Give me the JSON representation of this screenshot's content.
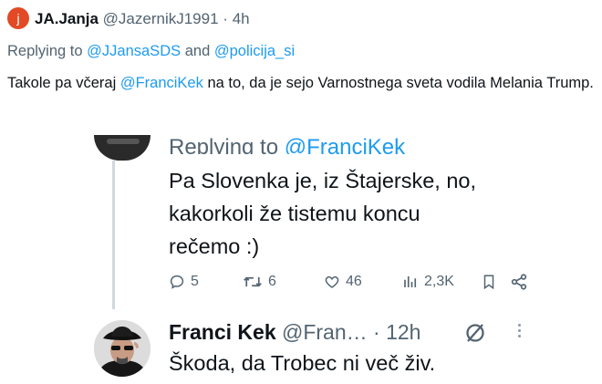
{
  "header": {
    "avatar_letter": "j",
    "display_name": "JA.Janja",
    "handle": "@JazernikJ1991",
    "separator": "·",
    "time": "4h"
  },
  "replying": {
    "prefix": "Replying to",
    "user1": "@JJansaSDS",
    "conj": "and",
    "user2": "@policija_si"
  },
  "body": {
    "text_before": "Takole pa včeraj  ",
    "mention": "@FranciKek",
    "text_after": " na to, da je sejo Varnostnega sveta  vodila Melania Trump."
  },
  "embed": {
    "replying_prefix": "Replying to",
    "replying_user": "@FranciKek",
    "lines": [
      "Pa Slovenka je, iz Štajerske, no,",
      "kakorkoli že tistemu koncu",
      "rečemo :)"
    ],
    "actions": {
      "replies": "5",
      "reposts": "6",
      "likes": "46",
      "views": "2,3K"
    }
  },
  "reply_tweet": {
    "display_name": "Franci Kek",
    "handle": "@Fran…",
    "separator": "·",
    "time": "12h",
    "text": "Škoda, da Trobec ni več živ."
  },
  "colors": {
    "link": "#1d9bf0",
    "muted": "#536471",
    "avatar_bg": "#e24a25"
  }
}
